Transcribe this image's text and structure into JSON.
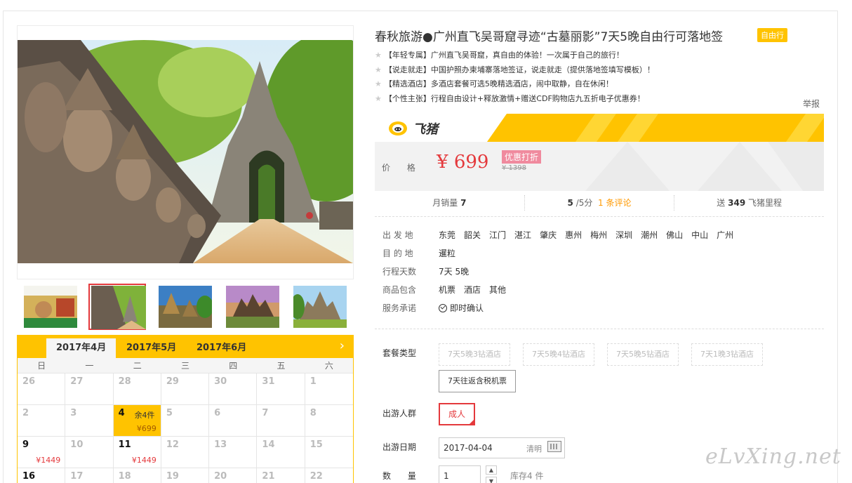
{
  "product": {
    "title": "春秋旅游●广州直飞吴哥窟寻迹“古墓丽影”7天5晚自由行可落地签",
    "tag": "自由行",
    "features": [
      "【年轻专属】广州直飞吴哥窟，真自由的体验！一次属于自己的旅行！",
      "【说走就走】中国护照办柬埔寨落地签证，说走就走（提供落地签填写模板）！",
      "【精选酒店】多酒店套餐可选5晚精选酒店，闹中取静，自在休闲！",
      "【个性主张】行程自由设计+释放激情+赠送CDF购物店九五折电子优惠券！"
    ],
    "report_label": "举报"
  },
  "brand": {
    "name": "飞猪",
    "colors": {
      "accent": "#ffc300",
      "price": "#e4393c",
      "link": "#ff9900"
    }
  },
  "price": {
    "label": "价 格",
    "symbol": "¥",
    "current": "699",
    "promo_tag": "优惠打折",
    "original": "¥ 1398"
  },
  "stats": {
    "monthly_sales_label": "月销量",
    "monthly_sales": "7",
    "rating": "5",
    "rating_suffix": "/5分",
    "reviews_link": "1 条评论",
    "points_prefix": "送",
    "points": "349",
    "points_suffix": "飞猪里程"
  },
  "info": {
    "departure_label": "出 发 地",
    "departures": [
      "东莞",
      "韶关",
      "江门",
      "湛江",
      "肇庆",
      "惠州",
      "梅州",
      "深圳",
      "潮州",
      "佛山",
      "中山",
      "广州"
    ],
    "destination_label": "目 的 地",
    "destination": "暹粒",
    "days_label": "行程天数",
    "days": "7天 5晚",
    "includes_label": "商品包含",
    "includes": [
      "机票",
      "酒店",
      "其他"
    ],
    "service_label": "服务承诺",
    "service": "即时确认"
  },
  "options": {
    "package_label": "套餐类型",
    "packages": [
      "7天5晚3钻酒店",
      "7天5晚4钻酒店",
      "7天5晚5钻酒店",
      "7天1晚3钻酒店",
      "7天往返含税机票"
    ],
    "crowd_label": "出游人群",
    "crowd": "成人",
    "date_label": "出游日期",
    "date": "2017-04-04",
    "clear_label": "清明",
    "qty_label": "数 量",
    "qty": "1",
    "stock": "库存4 件"
  },
  "calendar": {
    "months": [
      "2017年4月",
      "2017年5月",
      "2017年6月"
    ],
    "weekdays": [
      "日",
      "一",
      "二",
      "三",
      "四",
      "五",
      "六"
    ],
    "cells": [
      {
        "d": "26"
      },
      {
        "d": "27"
      },
      {
        "d": "28"
      },
      {
        "d": "29"
      },
      {
        "d": "30"
      },
      {
        "d": "31"
      },
      {
        "d": "1"
      },
      {
        "d": "2"
      },
      {
        "d": "3"
      },
      {
        "d": "4",
        "stock": "余4件",
        "price": "¥699",
        "selected": true
      },
      {
        "d": "5"
      },
      {
        "d": "6"
      },
      {
        "d": "7"
      },
      {
        "d": "8"
      },
      {
        "d": "9",
        "price": "¥1449",
        "avail": true
      },
      {
        "d": "10"
      },
      {
        "d": "11",
        "price": "¥1449",
        "avail": true
      },
      {
        "d": "12"
      },
      {
        "d": "13"
      },
      {
        "d": "14"
      },
      {
        "d": "15"
      },
      {
        "d": "16",
        "avail": true
      },
      {
        "d": "17"
      },
      {
        "d": "18"
      },
      {
        "d": "19"
      },
      {
        "d": "20"
      },
      {
        "d": "21"
      },
      {
        "d": "22"
      }
    ]
  },
  "watermark": "eLvXing.net"
}
